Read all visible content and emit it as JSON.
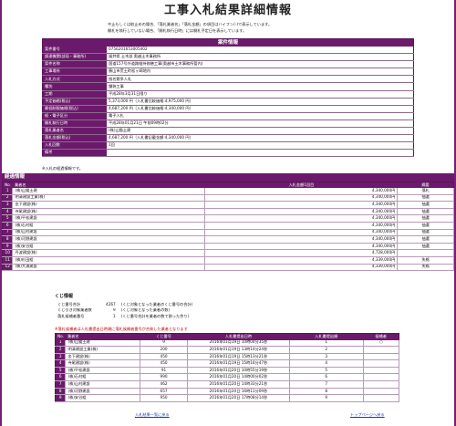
{
  "page": {
    "title": "工事入札結果詳細情報",
    "notice": [
      "中止もしくは取止めの場合、「落札業者名」「落札金額」の項目はハイフン(-)で表示しています。",
      "開札を執行していない場合、「開札執行日時」には開札予定日を表示しています。"
    ]
  },
  "case": {
    "header": "案件情報",
    "rows": [
      {
        "label": "案件番号",
        "value": "0756201653005402"
      },
      {
        "label": "調達機関(部局・事務所)",
        "value": "福井県 土木部 奥越土木事務所"
      },
      {
        "label": "案件名称",
        "value": "国道157号外道路維持修繕工事(奥越市土木事務所管内)"
      },
      {
        "label": "工事場所",
        "value": "勝山市荒土町松ヶ崎地内"
      },
      {
        "label": "入札方式",
        "value": "指名競争入札"
      },
      {
        "label": "種別",
        "value": "舗装工事"
      },
      {
        "label": "工期",
        "value": "平成28年3月31日限り"
      },
      {
        "label": "予定価格(税込)",
        "value": "5,373,000 円（入札書比較価格:4,975,000 円）"
      },
      {
        "label": "最低制限価格(税込)",
        "value": "4,687,200 円（入札書比較価格:4,340,000 円）"
      },
      {
        "label": "紙・電子区分",
        "value": "電子入札"
      },
      {
        "label": "開札執行日時",
        "value": "平成28年01月21日 午前09時02分"
      },
      {
        "label": "落札業者名",
        "value": "(株)山猫土建"
      },
      {
        "label": "落札金額(税込)",
        "value": "4,687,200 円（入札書記載金額:4,340,000 円）"
      },
      {
        "label": "入札回数",
        "value": "1回"
      },
      {
        "label": "備考",
        "value": ""
      }
    ]
  },
  "no_progress_note": "※入札の経過情報です。",
  "progress": {
    "band": "経過情報",
    "headers": {
      "no": "No.",
      "name": "業者名",
      "amount": "入札金額1回目",
      "result": "摘要"
    },
    "rows": [
      {
        "no": "1",
        "name": "(株)山猫土建",
        "amount": "4,340,000円",
        "result": "落札"
      },
      {
        "no": "2",
        "name": "明清建設工業(株)",
        "amount": "4,340,000円",
        "result": "抽選"
      },
      {
        "no": "3",
        "name": "金下建設(株)",
        "amount": "4,340,000円",
        "result": "抽選"
      },
      {
        "no": "4",
        "name": "寺尾建設(株)",
        "amount": "4,340,000円",
        "result": "抽選"
      },
      {
        "no": "5",
        "name": "(株)平松建設",
        "amount": "4,340,000円",
        "result": "抽選"
      },
      {
        "no": "6",
        "name": "(株)石村組",
        "amount": "4,340,000円",
        "result": "抽選"
      },
      {
        "no": "7",
        "name": "(株)山村建設",
        "amount": "4,340,000円",
        "result": "抽選"
      },
      {
        "no": "8",
        "name": "(株)河野建設",
        "amount": "4,340,000円",
        "result": "抽選"
      },
      {
        "no": "9",
        "name": "(株)安谷組",
        "amount": "4,340,000円",
        "result": "抽選"
      },
      {
        "no": "10",
        "name": "丹波建設(株)",
        "amount": "4,728,000円",
        "result": ""
      },
      {
        "no": "11",
        "name": "(株)杉田組",
        "amount": "4,339,000円",
        "result": "失格"
      },
      {
        "no": "12",
        "name": "(株)大浦建設",
        "amount": "4,339,000円",
        "result": "失格"
      }
    ]
  },
  "kuji": {
    "title": "くじ情報",
    "info": [
      {
        "label": "くじ番号合計",
        "value": "4267",
        "desc": "(くじ対象となった業者のくじ番号の合計)"
      },
      {
        "label": "くじ引き対象業者数",
        "value": "9",
        "desc": "(くじ対象となった業者の数)"
      },
      {
        "label": "落札候補者番号",
        "value": "1",
        "desc": "(くじ番号合計を業者の数で割った余り)"
      }
    ],
    "warning": "※落札候補者は入札書提出日時順に落札候補者番号が合致した業者となります",
    "headers": {
      "no": "No.",
      "name": "業者名",
      "kuji_no": "くじ番号",
      "date": "入札書提出日時",
      "order": "入札書提出順",
      "winner": "候補者"
    },
    "rows": [
      {
        "no": "1",
        "name": "(株)山猫土建",
        "kuji_no": "9",
        "date": "2016年01月19日 10時04分35秒",
        "order": "1",
        "winner": "○"
      },
      {
        "no": "2",
        "name": "明清建設工業(株)",
        "kuji_no": "200",
        "date": "2016年01月19日 13時14分24秒",
        "order": "2",
        "winner": ""
      },
      {
        "no": "3",
        "name": "金下建設(株)",
        "kuji_no": "450",
        "date": "2016年01月19日 15時13分21秒",
        "order": "3",
        "winner": ""
      },
      {
        "no": "4",
        "name": "寺尾建設(株)",
        "kuji_no": "450",
        "date": "2016年01月19日 15時16分47秒",
        "order": "4",
        "winner": ""
      },
      {
        "no": "5",
        "name": "(株)平松建設",
        "kuji_no": "91",
        "date": "2016年01月20日 10時55分19秒",
        "order": "5",
        "winner": ""
      },
      {
        "no": "6",
        "name": "(株)石村組",
        "kuji_no": "990",
        "date": "2016年01月20日 14時00分02秒",
        "order": "6",
        "winner": ""
      },
      {
        "no": "7",
        "name": "(株)山村建設",
        "kuji_no": "462",
        "date": "2016年01月20日 14時33分21秒",
        "order": "7",
        "winner": ""
      },
      {
        "no": "8",
        "name": "(株)河野建設",
        "kuji_no": "657",
        "date": "2016年01月20日 16時11分09秒",
        "order": "8",
        "winner": ""
      },
      {
        "no": "9",
        "name": "(株)安谷組",
        "kuji_no": "950",
        "date": "2016年01月20日 17時08分14秒",
        "order": "9",
        "winner": ""
      }
    ]
  },
  "footer": {
    "back": "入札結果一覧に戻る",
    "top": "トップページへ戻る"
  }
}
